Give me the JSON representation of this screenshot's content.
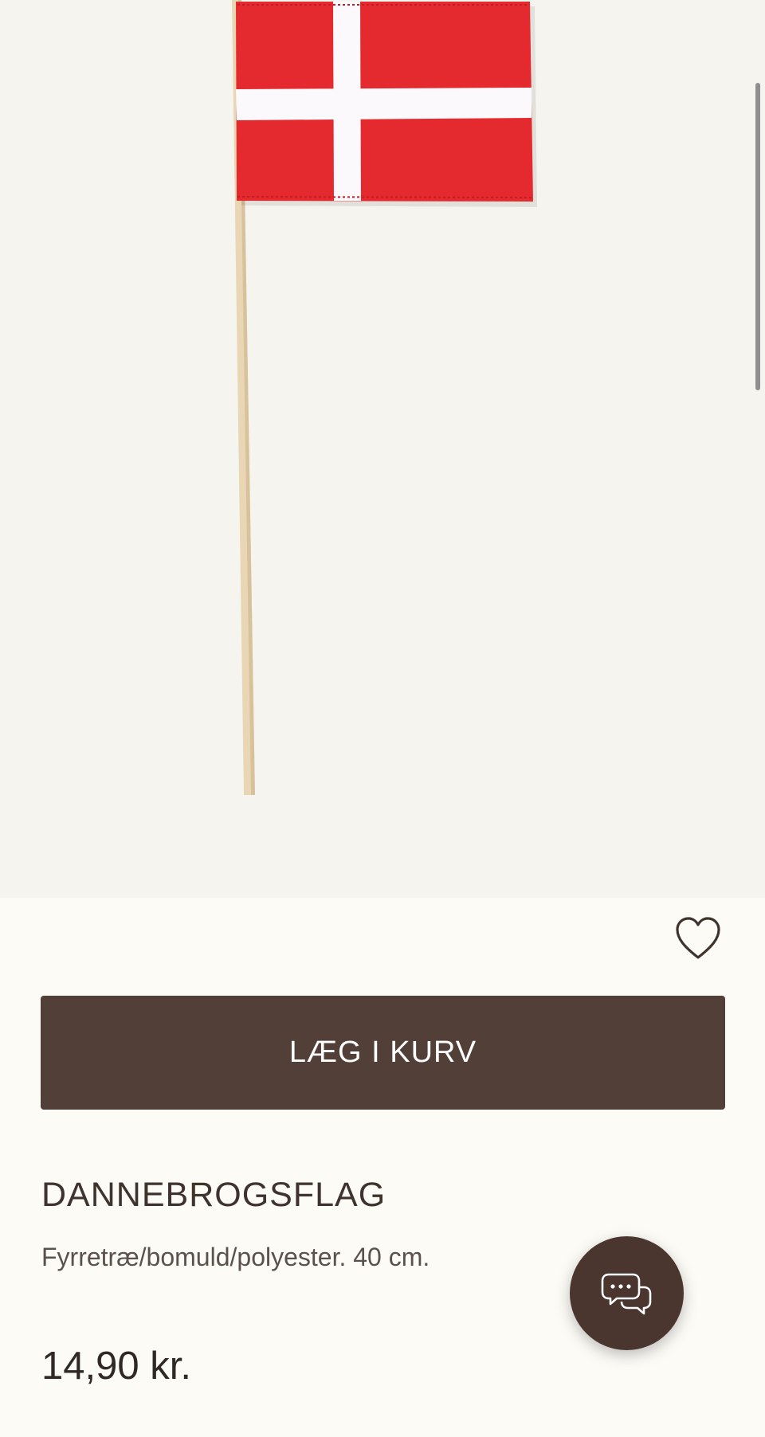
{
  "product": {
    "title": "DANNEBROGSFLAG",
    "description": "Fyrretræ/bomuld/polyester. 40 cm.",
    "price": "14,90 kr."
  },
  "actions": {
    "add_to_cart_label": "LÆG I KURV"
  },
  "icons": {
    "wishlist": "heart-icon",
    "chat": "chat-bubbles-icon"
  },
  "colors": {
    "button": "#523f37",
    "chat_button": "#4a352f",
    "image_background": "#f6f4ee",
    "page_background": "#fcfbf6",
    "flag_red": "#e42a2e"
  }
}
